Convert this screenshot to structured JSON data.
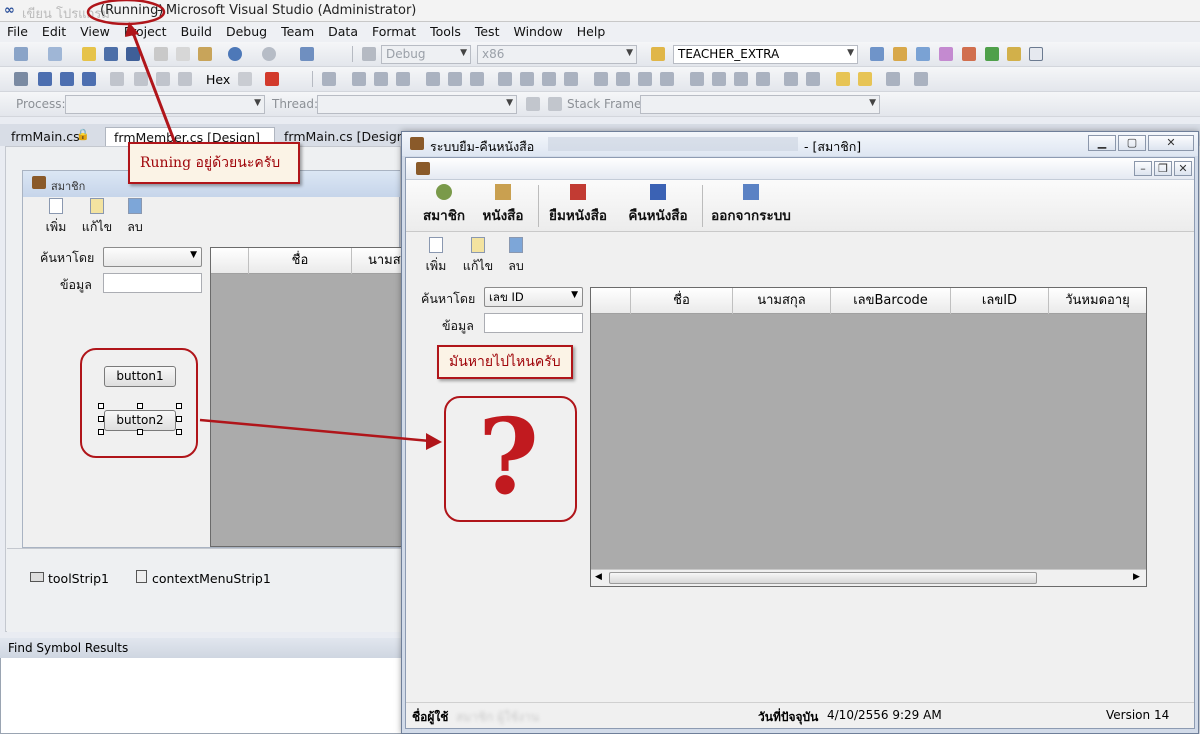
{
  "vs": {
    "title_prefix": "เขียน โปรแกรม",
    "running": "(Running)",
    "title_suffix": " - Microsoft Visual Studio (Administrator)",
    "menu": [
      "File",
      "Edit",
      "View",
      "Project",
      "Build",
      "Debug",
      "Team",
      "Data",
      "Format",
      "Tools",
      "Test",
      "Window",
      "Help"
    ],
    "toolbar": {
      "config": "Debug",
      "platform": "x86",
      "startup_project": "TEACHER_EXTRA",
      "hex_label": "Hex",
      "process_label": "Process:",
      "thread_label": "Thread:",
      "stackframe_label": "Stack Frame:"
    },
    "tabs": [
      "frmMain.cs",
      "frmMember.cs [Design]",
      "frmMain.cs [Design]"
    ],
    "find_panel_title": "Find Symbol Results"
  },
  "designer": {
    "form_title": "สมาชิก",
    "toolbar": [
      "เพิ่ม",
      "แก้ไข",
      "ลบ"
    ],
    "search_label": "ค้นหาโดย",
    "data_label": "ข้อมูล",
    "grid_cols": [
      "ชื่อ",
      "นามส"
    ],
    "button1": "button1",
    "button2": "button2",
    "tray": [
      "toolStrip1",
      "contextMenuStrip1"
    ]
  },
  "app": {
    "window_title": "ระบบยืม-คืนหนังสือ",
    "window_title_suffix": "- [สมาชิก]",
    "main_menu": [
      "สมาชิก",
      "หนังสือ",
      "ยืมหนังสือ",
      "คืนหนังสือ",
      "ออกจากระบบ"
    ],
    "sub_toolbar": [
      "เพิ่ม",
      "แก้ไข",
      "ลบ"
    ],
    "search_label": "ค้นหาโดย",
    "search_value": "เลข ID",
    "data_label": "ข้อมูล",
    "grid_cols": [
      "ชื่อ",
      "นามสกุล",
      "เลขBarcode",
      "เลขID",
      "วันหมดอายุ"
    ],
    "status_user_label": "ชื่อผู้ใช้",
    "status_user_value": "สมาชิก ผู้ใช้งาน",
    "status_date_label": "วันที่ปัจจุบัน",
    "status_date_value": "4/10/2556 9:29 AM",
    "status_version": "Version 14"
  },
  "annotations": {
    "running_note": "Runing อยู่ด้วยนะครับ",
    "missing_note": "มันหายไปไหนครับ",
    "question": "?"
  },
  "colors": {
    "annotation": "#b0151a",
    "grid_bg": "#ababab"
  }
}
